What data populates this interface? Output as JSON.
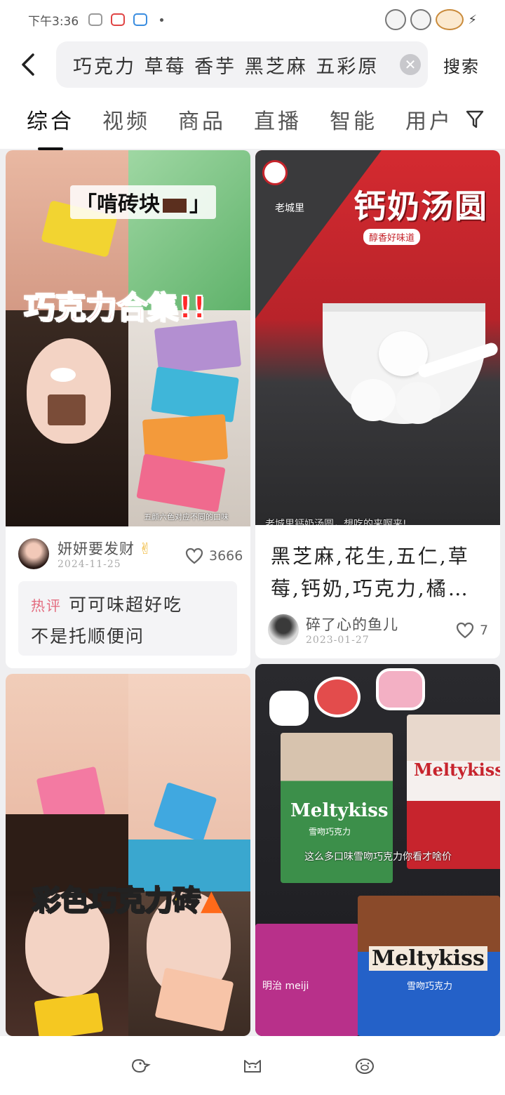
{
  "status_bar": {
    "time": "下午3:36"
  },
  "search": {
    "query": "巧克力 草莓 香芋 黑芝麻 五彩原",
    "button_label": "搜索"
  },
  "tabs": [
    {
      "label": "综合",
      "active": true
    },
    {
      "label": "视频"
    },
    {
      "label": "商品"
    },
    {
      "label": "直播"
    },
    {
      "label": "智能"
    },
    {
      "label": "用户"
    }
  ],
  "feed": {
    "card1": {
      "overlay_quote": "「啃砖块",
      "overlay_quote_end": "」",
      "overlay_title": "巧克力合集",
      "overlay_title_suffix": "!!",
      "caption": "五颜六色对应不同的口味",
      "author": "妍妍要发财",
      "date": "2024-11-25",
      "likes": "3666",
      "hot_label": "热评",
      "hot_comment_1": "可可味超好吃",
      "hot_comment_2": "不是托顺便问"
    },
    "card2": {
      "brand": "老城里",
      "product": "钙奶汤圆",
      "tagline": "醇香好味道",
      "caption": "老城里钙奶汤圆，想吃的来啊来!",
      "title": "黑芝麻,花生,五仁,草莓,钙奶,巧克力,橘…",
      "author": "碎了心的鱼儿",
      "date": "2023-01-27",
      "likes": "7"
    },
    "card3": {
      "overlay_title": "彩色巧克力砖"
    },
    "card4": {
      "brand": "Meltykiss",
      "subtitle": "雪吻巧克力",
      "caption": "这么多口味雪吻巧克力你看才啥价",
      "maker": "明治 meiji"
    }
  },
  "colors": {
    "accent_red": "#e3212b",
    "hot_pink": "#e36b7e"
  }
}
